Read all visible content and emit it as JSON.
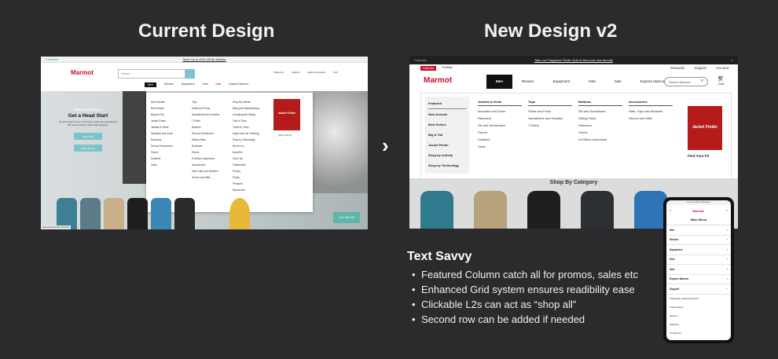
{
  "headings": {
    "left": "Current Design",
    "right": "New Design v2"
  },
  "arrow": "›",
  "current": {
    "promo_brand": "Coleman",
    "promo_text": "Save Up to 40% Off all Jackets",
    "logo": "Marmot",
    "search_placeholder": "Search",
    "icons": [
      "Welcome",
      "Support",
      "Marmot Rewards",
      "Cart"
    ],
    "nav": [
      "Men",
      "Women",
      "Equipment",
      "Kids",
      "Sale",
      "Explore Marmot"
    ],
    "hero": {
      "subtitle": "NEW FALL ARRIVALS",
      "title": "Get a Head Start",
      "body": "You don't have to let go of summer to step into step ahead of fall. Gear up before nature start dropping.",
      "btn1": "Shop Men",
      "btn2": "Shop Women"
    },
    "columns": [
      {
        "items": [
          "New Arrivals",
          "Best Sellers",
          "Big and Tall",
          "Jacket Finder",
          "Jackets & Vests",
          "Insulated and Down",
          "Rainwear",
          "Ski and Snowboard",
          "Fleece",
          "Softshell",
          "Vests"
        ]
      },
      {
        "items": [
          "Tops",
          "Shirts and Polos",
          "Sweatshirts and Hoodies",
          "T-Shirts",
          "Bottoms",
          "Ski and Snowboard",
          "Hiking Pants",
          "Rainwear",
          "Shorts",
          "ExoRicio Underwear",
          "Accessories",
          "Hats Caps and Beanies",
          "Gloves and Mitts"
        ]
      },
      {
        "items": [
          "Shop By Activity",
          "Biking and Backpacking",
          "Camping and Hiking",
          "Trail to Town",
          "Travel to Town",
          "Alpine and Ice Climbing",
          "Shop by Technology",
          "Storm Lox",
          "NanoPro",
          "Gore-Tex",
          "Featherless",
          "Evodry",
          "Precip",
          "Primaloft",
          "WarmCube"
        ]
      }
    ],
    "jacket_finder": "Jacket Finder",
    "find_fit": "Find Your Fit",
    "offer": "Get 15% Off",
    "status_url": "https://www.marmot.com/mens"
  },
  "new": {
    "promo_brand": "Coleman",
    "promo_text": "Take our Fragrance Finder Quiz to find your new favorite",
    "close": "×",
    "brands": [
      "Coleman",
      "Exofficio"
    ],
    "top_links": [
      "Rewards",
      "Support",
      "Account"
    ],
    "logo": "Marmot",
    "nav": [
      "Men",
      "Women",
      "Equipment",
      "Kids",
      "Sale",
      "Explore Marmot"
    ],
    "search_placeholder": "Search Marmot",
    "cart": "Cart",
    "featured_title": "Featured",
    "featured": [
      "New Arrivals",
      "Best Sellers",
      "Big & Tall",
      "Jacket Finder",
      "Shop by Activity",
      "Shop by Technology"
    ],
    "columns": [
      {
        "title": "Jackets & Vests",
        "items": [
          "Insulated and Down",
          "Rainwear",
          "Ski and Snowboard",
          "Fleece",
          "Softshell",
          "Vests"
        ]
      },
      {
        "title": "Tops",
        "items": [
          "Shirts and Polos",
          "Sweatshirts and Hoodies",
          "T-Shirts"
        ]
      },
      {
        "title": "Bottoms",
        "items": [
          "Ski and Snowboard",
          "Hiking Pants",
          "Rainwear",
          "Shorts",
          "ExOfficio Underwear"
        ]
      },
      {
        "title": "Accessories",
        "items": [
          "Hats, Caps and Beanies",
          "Gloves and Mitts"
        ]
      }
    ],
    "jacket_finder": "Jacket Finder",
    "find_fit": "Find Your Fit",
    "shop_by_category": "Shop By Category"
  },
  "phone": {
    "bar": "save up to 40% off all jackets",
    "logo": "Marmot",
    "title": "Main Menu",
    "items": [
      "Men",
      "Women",
      "Equipment",
      "Kids",
      "Sale",
      "Explore Marmot"
    ],
    "support_label": "Support",
    "support_items": [
      "Frequently Asked Questions",
      "Track Orders",
      "Returns",
      "Warranty",
      "Contact Us"
    ]
  },
  "savvy": {
    "title": "Text Savvy",
    "bullets": [
      "Featured Column catch all for promos, sales etc",
      "Enhanced Grid system ensures readibility ease",
      "Clickable L2s can act as “shop all”",
      "Second row can be added if needed"
    ]
  },
  "colors": {
    "background": "#2b2b2d",
    "brand_red": "#c8102e",
    "teal": "#7dc3c9"
  }
}
